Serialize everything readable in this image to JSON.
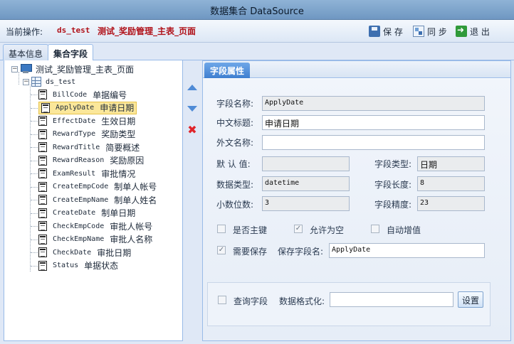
{
  "window": {
    "title": "数据集合  DataSource"
  },
  "toolbar": {
    "op_label": "当前操作:",
    "op_code": "ds_test",
    "op_name": "测试_奖励管理_主表_页面",
    "save_label": "保 存",
    "sync_label": "同 步",
    "exit_label": "退 出"
  },
  "tabs": {
    "basic": "基本信息",
    "fields": "集合字段"
  },
  "tree": {
    "root": "测试_奖励管理_主表_页面",
    "dataset": "ds_test",
    "fields": [
      {
        "code": "BillCode",
        "name": "单据编号"
      },
      {
        "code": "ApplyDate",
        "name": "申请日期"
      },
      {
        "code": "EffectDate",
        "name": "生效日期"
      },
      {
        "code": "RewardType",
        "name": "奖励类型"
      },
      {
        "code": "RewardTitle",
        "name": "简要概述"
      },
      {
        "code": "RewardReason",
        "name": "奖励原因"
      },
      {
        "code": "ExamResult",
        "name": "审批情况"
      },
      {
        "code": "CreateEmpCode",
        "name": "制单人帐号"
      },
      {
        "code": "CreateEmpName",
        "name": "制单人姓名"
      },
      {
        "code": "CreateDate",
        "name": "制单日期"
      },
      {
        "code": "CheckEmpCode",
        "name": "审批人帐号"
      },
      {
        "code": "CheckEmpName",
        "name": "审批人名称"
      },
      {
        "code": "CheckDate",
        "name": "审批日期"
      },
      {
        "code": "Status",
        "name": "单据状态"
      }
    ]
  },
  "props": {
    "tab_label": "字段属性",
    "field_name_label": "字段名称:",
    "field_name_value": "ApplyDate",
    "cn_title_label": "中文标题:",
    "cn_title_value": "申请日期",
    "foreign_name_label": "外文名称:",
    "foreign_name_value": "",
    "default_label": "默 认 值:",
    "default_value": "",
    "field_type_label": "字段类型:",
    "field_type_value": "日期",
    "data_type_label": "数据类型:",
    "data_type_value": "datetime",
    "field_length_label": "字段长度:",
    "field_length_value": "8",
    "decimal_label": "小数位数:",
    "decimal_value": "3",
    "precision_label": "字段精度:",
    "precision_value": "23",
    "is_pk_label": "是否主键",
    "allow_null_label": "允许为空",
    "auto_inc_label": "自动增值",
    "need_save_label": "需要保存",
    "save_field_label": "保存字段名:",
    "save_field_value": "ApplyDate",
    "query_field_label": "查询字段",
    "format_label": "数据格式化:",
    "format_value": "",
    "set_label": "设置"
  }
}
